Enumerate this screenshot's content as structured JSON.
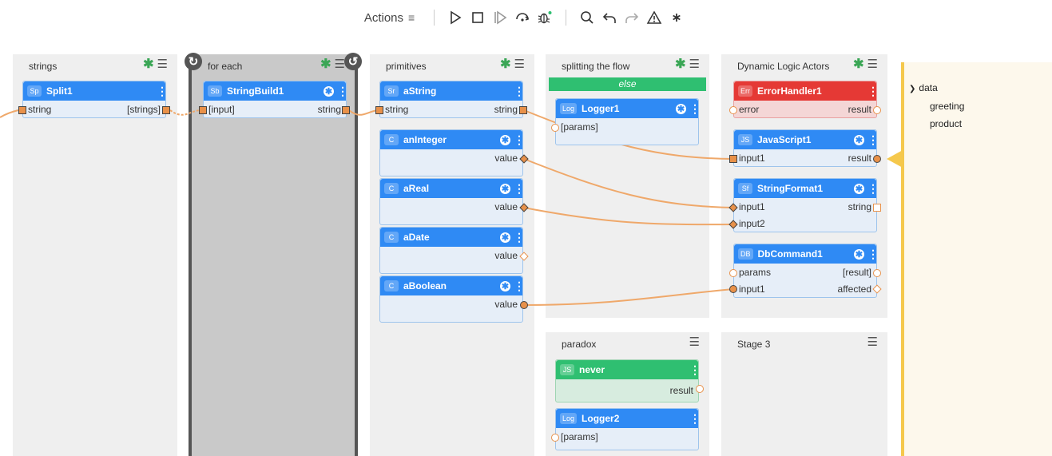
{
  "toolbar": {
    "label": "Actions",
    "menu_glyph": "≡",
    "buttons": [
      "play-icon",
      "stop-icon",
      "step-icon",
      "step-over-icon",
      "debug-icon",
      "search-icon",
      "undo-icon",
      "redo-icon",
      "warning-icon",
      "asterisk-icon"
    ]
  },
  "stages": {
    "strings": "strings",
    "foreach": "for each",
    "primitives": "primitives",
    "splitting": "splitting the flow",
    "dynamic": "Dynamic Logic Actors",
    "paradox": "paradox",
    "stage3": "Stage 3"
  },
  "else_label": "else",
  "nodes": {
    "split1": {
      "badge": "Sp",
      "name": "Split1",
      "in": "string",
      "out": "[strings]"
    },
    "stringbuild1": {
      "badge": "Sb",
      "name": "StringBuild1",
      "in": "[input]",
      "out": "string"
    },
    "astring": {
      "badge": "Sr",
      "name": "aString",
      "in": "string",
      "out": "string"
    },
    "aninteger": {
      "badge": "C",
      "name": "anInteger",
      "out": "value"
    },
    "areal": {
      "badge": "C",
      "name": "aReal",
      "out": "value"
    },
    "adate": {
      "badge": "C",
      "name": "aDate",
      "out": "value"
    },
    "aboolean": {
      "badge": "C",
      "name": "aBoolean",
      "out": "value"
    },
    "logger1": {
      "badge": "Log",
      "name": "Logger1",
      "in": "[params]"
    },
    "errorhandler1": {
      "badge": "Err",
      "name": "ErrorHandler1",
      "in": "error",
      "out": "result"
    },
    "javascript1": {
      "badge": "JS",
      "name": "JavaScript1",
      "in": "input1",
      "out": "result"
    },
    "stringformat1": {
      "badge": "Sf",
      "name": "StringFormat1",
      "in1": "input1",
      "in2": "input2",
      "out": "string"
    },
    "dbcommand1": {
      "badge": "DB",
      "name": "DbCommand1",
      "in1": "params",
      "in2": "input1",
      "out1": "[result]",
      "out2": "affected"
    },
    "never": {
      "badge": "JS",
      "name": "never",
      "out": "result"
    },
    "logger2": {
      "badge": "Log",
      "name": "Logger2",
      "in": "[params]"
    }
  },
  "tree": {
    "root": "data",
    "children": [
      "greeting",
      "product"
    ]
  },
  "colors": {
    "node_header": "#2f8af4",
    "error_header": "#e53935",
    "success_header": "#2fbf71",
    "wire": "#efa86a",
    "accent": "#f5c84c"
  }
}
